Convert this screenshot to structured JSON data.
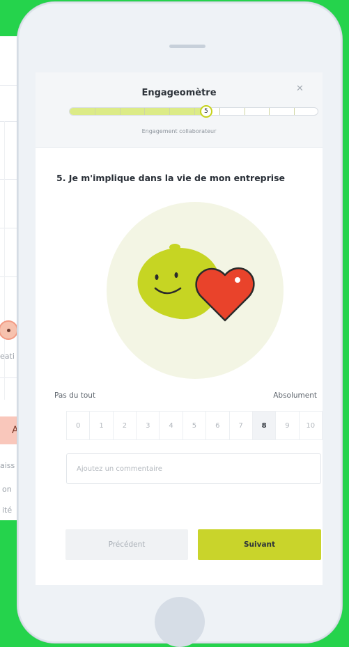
{
  "background_window": {
    "button_fragment": "Ac",
    "label_fragment": "eati",
    "text_lines": [
      "aiss",
      "on",
      "ité"
    ]
  },
  "survey": {
    "title": "Engageomètre",
    "close_icon": "close-icon",
    "progress": {
      "current_step": 5,
      "total_steps": 10,
      "value": 0.55
    },
    "progress_caption": "Engagement collaborateur",
    "question": "5. Je m'implique dans la vie de mon entreprise",
    "illustration": [
      "lemon-smiley-icon",
      "heart-icon"
    ],
    "scale": {
      "min_label": "Pas du tout",
      "max_label": "Absolument",
      "values": [
        "0",
        "1",
        "2",
        "3",
        "4",
        "5",
        "6",
        "7",
        "8",
        "9",
        "10"
      ],
      "selected": "8"
    },
    "comment_placeholder": "Ajoutez un commentaire",
    "prev_label": "Précédent",
    "next_label": "Suivant"
  },
  "colors": {
    "background": "#25d34c",
    "accent": "#c9d42b",
    "progress_fill": "#dceb87",
    "heart": "#e9432b"
  }
}
